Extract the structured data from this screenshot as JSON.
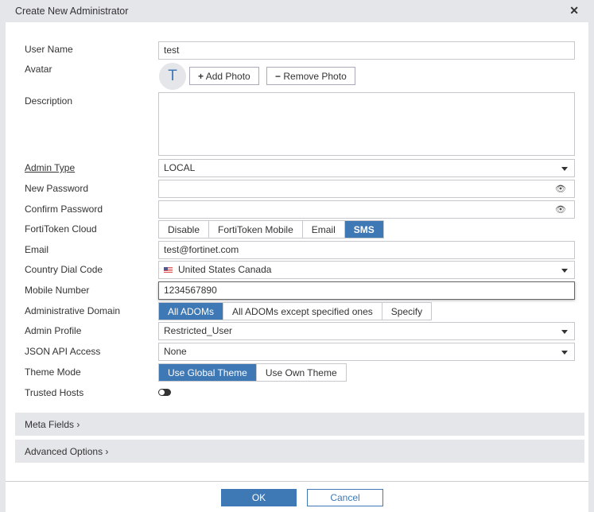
{
  "dialog": {
    "title": "Create New Administrator",
    "close_icon": "close-icon"
  },
  "labels": {
    "user_name": "User Name",
    "avatar": "Avatar",
    "description": "Description",
    "admin_type": "Admin Type",
    "new_password": "New Password",
    "confirm_password": "Confirm Password",
    "fortitoken": "FortiToken Cloud",
    "email": "Email",
    "country": "Country Dial Code",
    "mobile": "Mobile Number",
    "adom": "Administrative Domain",
    "profile": "Admin Profile",
    "json": "JSON API Access",
    "theme": "Theme Mode",
    "trusted": "Trusted Hosts"
  },
  "values": {
    "user_name": "test",
    "avatar_letter": "T",
    "description": "",
    "admin_type": "LOCAL",
    "email": "test@fortinet.com",
    "country": "United States Canada",
    "mobile": "1234567890",
    "profile": "Restricted_User",
    "json": "None"
  },
  "buttons": {
    "add_photo": "Add Photo",
    "remove_photo": "Remove Photo",
    "ok": "OK",
    "cancel": "Cancel"
  },
  "fortitoken_options": [
    "Disable",
    "FortiToken Mobile",
    "Email",
    "SMS"
  ],
  "adom_options": [
    "All ADOMs",
    "All ADOMs except specified ones",
    "Specify"
  ],
  "theme_options": [
    "Use Global Theme",
    "Use Own Theme"
  ],
  "sections": {
    "meta": "Meta Fields",
    "advanced": "Advanced Options"
  },
  "colors": {
    "accent": "#3e78b5"
  }
}
